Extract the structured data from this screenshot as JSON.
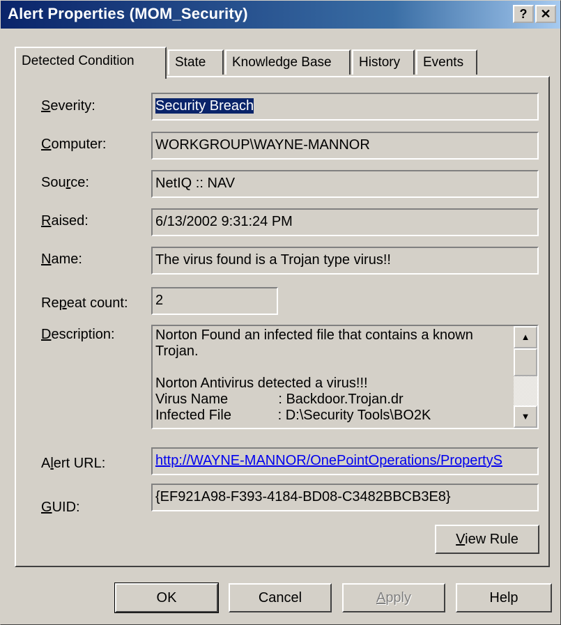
{
  "window": {
    "title": "Alert Properties (MOM_Security)",
    "help_button": "?",
    "close_button": "✕"
  },
  "tabs": [
    {
      "label": "Detected Condition",
      "active": true
    },
    {
      "label": "State",
      "active": false
    },
    {
      "label": "Knowledge Base",
      "active": false
    },
    {
      "label": "History",
      "active": false
    },
    {
      "label": "Events",
      "active": false
    }
  ],
  "fields": {
    "severity": {
      "label_key": "S",
      "label_rest": "everity:",
      "value": "Security Breach"
    },
    "computer": {
      "label_key": "C",
      "label_rest": "omputer:",
      "value": "WORKGROUP\\WAYNE-MANNOR"
    },
    "source": {
      "label_pre": "Sou",
      "label_key": "r",
      "label_rest": "ce:",
      "value": "NetIQ :: NAV"
    },
    "raised": {
      "label_key": "R",
      "label_rest": "aised:",
      "value": "6/13/2002 9:31:24 PM"
    },
    "name": {
      "label_key": "N",
      "label_rest": "ame:",
      "value": "The virus found is a Trojan type virus!!"
    },
    "repeat_count": {
      "label_pre": "Re",
      "label_key": "p",
      "label_rest": "eat count:",
      "value": "2"
    },
    "description": {
      "label_key": "D",
      "label_rest": "escription:",
      "value": "Norton Found an infected file that contains a known\nTrojan.\n\nNorton Antivirus detected a virus!!!\nVirus Name             : Backdoor.Trojan.dr\nInfected File            : D:\\Security Tools\\BO2K"
    },
    "alert_url": {
      "label_pre": "A",
      "label_key": "l",
      "label_rest": "ert URL:",
      "value": "http://WAYNE-MANNOR/OnePointOperations/PropertyS"
    },
    "guid": {
      "label_key": "G",
      "label_rest": "UID:",
      "value": "{EF921A98-F393-4184-BD08-C3482BBCB3E8}"
    }
  },
  "scrollbar": {
    "up_arrow": "▲",
    "down_arrow": "▼"
  },
  "buttons": {
    "view_rule": {
      "label_key": "V",
      "label_rest": "iew Rule"
    },
    "ok": "OK",
    "cancel": "Cancel",
    "apply": {
      "label_key": "A",
      "label_rest": "pply"
    },
    "help": "Help"
  }
}
